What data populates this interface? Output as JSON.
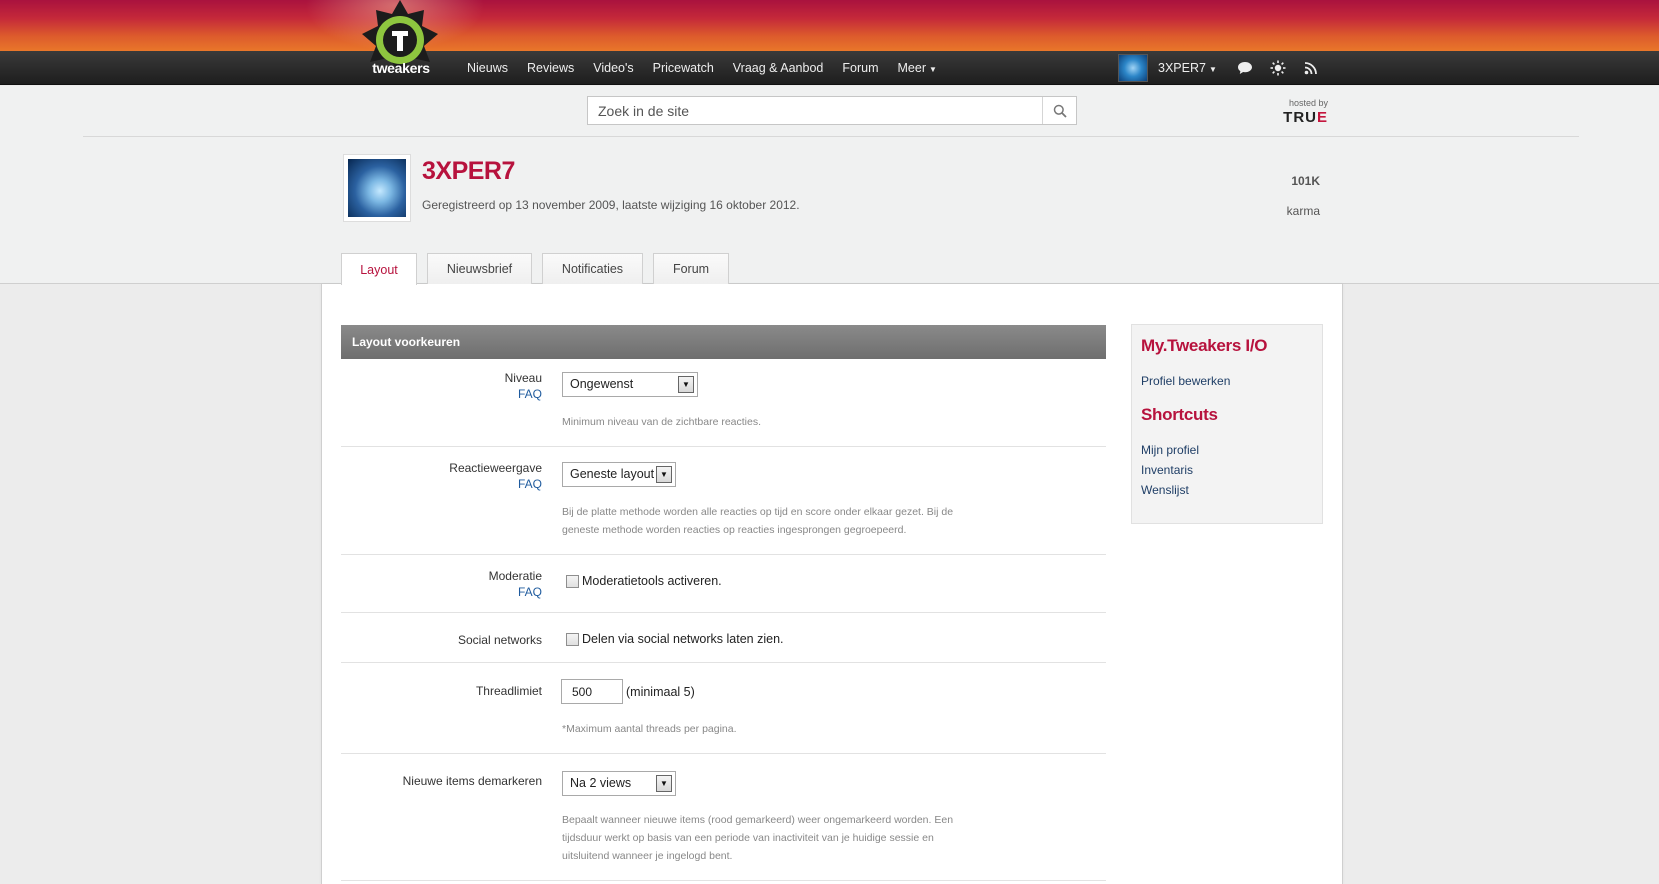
{
  "nav": {
    "logo_text": "tweakers",
    "links": [
      "Nieuws",
      "Reviews",
      "Video's",
      "Pricewatch",
      "Vraag & Aanbod",
      "Forum",
      "Meer"
    ],
    "user_name": "3XPER7"
  },
  "search": {
    "placeholder": "Zoek in de site"
  },
  "hosted": {
    "label": "hosted by",
    "brand_main": "TRU",
    "brand_accent": "E"
  },
  "profile": {
    "name": "3XPER7",
    "meta": "Geregistreerd op 13 november 2009, laatste wijziging 16 oktober 2012.",
    "karma_value": "101K",
    "karma_label": "karma"
  },
  "tabs": [
    "Layout",
    "Nieuwsbrief",
    "Notificaties",
    "Forum"
  ],
  "section": {
    "title": "Layout voorkeuren",
    "rows": {
      "niveau": {
        "label": "Niveau",
        "faq": "FAQ",
        "value": "Ongewenst",
        "help": "Minimum niveau van de zichtbare reacties."
      },
      "reactie": {
        "label": "Reactieweergave",
        "faq": "FAQ",
        "value": "Geneste layout",
        "help1": "Bij de platte methode worden alle reacties op tijd en score onder elkaar gezet. Bij de",
        "help2": "geneste methode worden reacties op reacties ingesprongen gegroepeerd."
      },
      "moderatie": {
        "label": "Moderatie",
        "faq": "FAQ",
        "checkbox": "Moderatietools activeren."
      },
      "social": {
        "label": "Social networks",
        "checkbox": "Delen via social networks laten zien."
      },
      "thread": {
        "label": "Threadlimiet",
        "value": "500",
        "suffix": "(minimaal 5)",
        "help": "*Maximum aantal threads per pagina."
      },
      "demarkeren": {
        "label": "Nieuwe items demarkeren",
        "value": "Na 2 views",
        "help1": "Bepaalt wanneer nieuwe items (rood gemarkeerd) weer ongemarkeerd worden. Een",
        "help2": "tijdsduur werkt op basis van een periode van inactiviteit van je huidige sessie en",
        "help3": "uitsluitend wanneer je ingelogd bent."
      }
    }
  },
  "sidebar": {
    "heading1": "My.Tweakers I/O",
    "link_profile_edit": "Profiel bewerken",
    "heading2": "Shortcuts",
    "shortcuts": [
      "Mijn profiel",
      "Inventaris",
      "Wenslijst"
    ]
  },
  "colors": {
    "accent": "#b7123d",
    "link": "#1f5b9e",
    "nav_bg": "#2a2a2a",
    "band_top": "#a9123e",
    "band_bottom": "#e9772a"
  }
}
